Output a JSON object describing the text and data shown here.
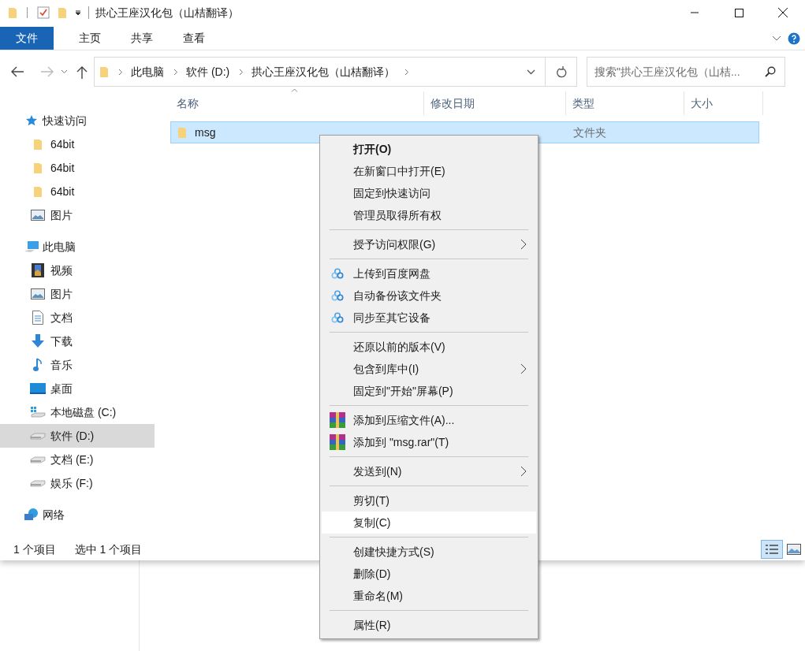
{
  "window": {
    "title": "拱心王座汉化包（山桔翻译）"
  },
  "ribbon_tabs": [
    {
      "label": "文件",
      "selected": true
    },
    {
      "label": "主页",
      "selected": false
    },
    {
      "label": "共享",
      "selected": false
    },
    {
      "label": "查看",
      "selected": false
    }
  ],
  "address_bar": {
    "crumbs": [
      "此电脑",
      "软件 (D:)",
      "拱心王座汉化包（山桔翻译）"
    ]
  },
  "search": {
    "placeholder": "搜索\"拱心王座汉化包（山桔..."
  },
  "sidebar": {
    "items": [
      {
        "label": "快速访问",
        "kind": "star",
        "selected": false,
        "children": [
          {
            "label": "64bit",
            "kind": "folder",
            "selected": false
          },
          {
            "label": "64bit",
            "kind": "folder",
            "selected": false
          },
          {
            "label": "64bit",
            "kind": "folder",
            "selected": false
          },
          {
            "label": "图片",
            "kind": "pictures",
            "selected": false
          }
        ]
      },
      {
        "label": "此电脑",
        "kind": "computer",
        "selected": false,
        "children": [
          {
            "label": "视频",
            "kind": "video",
            "selected": false
          },
          {
            "label": "图片",
            "kind": "pictures",
            "selected": false
          },
          {
            "label": "文档",
            "kind": "documents",
            "selected": false
          },
          {
            "label": "下载",
            "kind": "downloads",
            "selected": false
          },
          {
            "label": "音乐",
            "kind": "music",
            "selected": false
          },
          {
            "label": "桌面",
            "kind": "desktop",
            "selected": false
          },
          {
            "label": "本地磁盘 (C:)",
            "kind": "system-drive",
            "selected": false
          },
          {
            "label": "软件 (D:)",
            "kind": "drive",
            "selected": true
          },
          {
            "label": "文档 (E:)",
            "kind": "drive",
            "selected": false
          },
          {
            "label": "娱乐 (F:)",
            "kind": "drive",
            "selected": false
          }
        ]
      },
      {
        "label": "网络",
        "kind": "network",
        "selected": false
      }
    ]
  },
  "table": {
    "columns": [
      "名称",
      "修改日期",
      "类型",
      "大小"
    ],
    "rows": [
      {
        "name": "msg",
        "type": "文件夹",
        "selected": true
      }
    ]
  },
  "context_menu": {
    "groups": [
      {
        "items": [
          {
            "label": "打开(O)",
            "kind": "plain",
            "default": true,
            "submenu": false,
            "selected": false
          },
          {
            "label": "在新窗口中打开(E)",
            "kind": "plain",
            "default": false,
            "submenu": false,
            "selected": false
          },
          {
            "label": "固定到快速访问",
            "kind": "plain",
            "default": false,
            "submenu": false,
            "selected": false
          },
          {
            "label": "管理员取得所有权",
            "kind": "plain",
            "default": false,
            "submenu": false,
            "selected": false
          }
        ]
      },
      {
        "items": [
          {
            "label": "授予访问权限(G)",
            "kind": "plain",
            "default": false,
            "submenu": true,
            "selected": false
          }
        ]
      },
      {
        "items": [
          {
            "label": "上传到百度网盘",
            "kind": "cloud",
            "default": false,
            "submenu": false,
            "selected": false
          },
          {
            "label": "自动备份该文件夹",
            "kind": "cloud",
            "default": false,
            "submenu": false,
            "selected": false
          },
          {
            "label": "同步至其它设备",
            "kind": "cloud",
            "default": false,
            "submenu": false,
            "selected": false
          }
        ]
      },
      {
        "items": [
          {
            "label": "还原以前的版本(V)",
            "kind": "plain",
            "default": false,
            "submenu": false,
            "selected": false
          },
          {
            "label": "包含到库中(I)",
            "kind": "plain",
            "default": false,
            "submenu": true,
            "selected": false
          },
          {
            "label": "固定到\"开始\"屏幕(P)",
            "kind": "plain",
            "default": false,
            "submenu": false,
            "selected": false
          }
        ]
      },
      {
        "items": [
          {
            "label": "添加到压缩文件(A)...",
            "kind": "archive",
            "default": false,
            "submenu": false,
            "selected": false
          },
          {
            "label": "添加到 \"msg.rar\"(T)",
            "kind": "archive",
            "default": false,
            "submenu": false,
            "selected": false
          }
        ]
      },
      {
        "items": [
          {
            "label": "发送到(N)",
            "kind": "plain",
            "default": false,
            "submenu": true,
            "selected": false
          }
        ]
      },
      {
        "items": [
          {
            "label": "剪切(T)",
            "kind": "plain",
            "default": false,
            "submenu": false,
            "selected": false
          },
          {
            "label": "复制(C)",
            "kind": "plain",
            "default": false,
            "submenu": false,
            "selected": true
          }
        ]
      },
      {
        "items": [
          {
            "label": "创建快捷方式(S)",
            "kind": "plain",
            "default": false,
            "submenu": false,
            "selected": false
          },
          {
            "label": "删除(D)",
            "kind": "plain",
            "default": false,
            "submenu": false,
            "selected": false
          },
          {
            "label": "重命名(M)",
            "kind": "plain",
            "default": false,
            "submenu": false,
            "selected": false
          }
        ]
      },
      {
        "items": [
          {
            "label": "属性(R)",
            "kind": "plain",
            "default": false,
            "submenu": false,
            "selected": false
          }
        ]
      }
    ]
  },
  "status_bar": {
    "count": "1 个项目",
    "selection": "选中 1 个项目"
  }
}
